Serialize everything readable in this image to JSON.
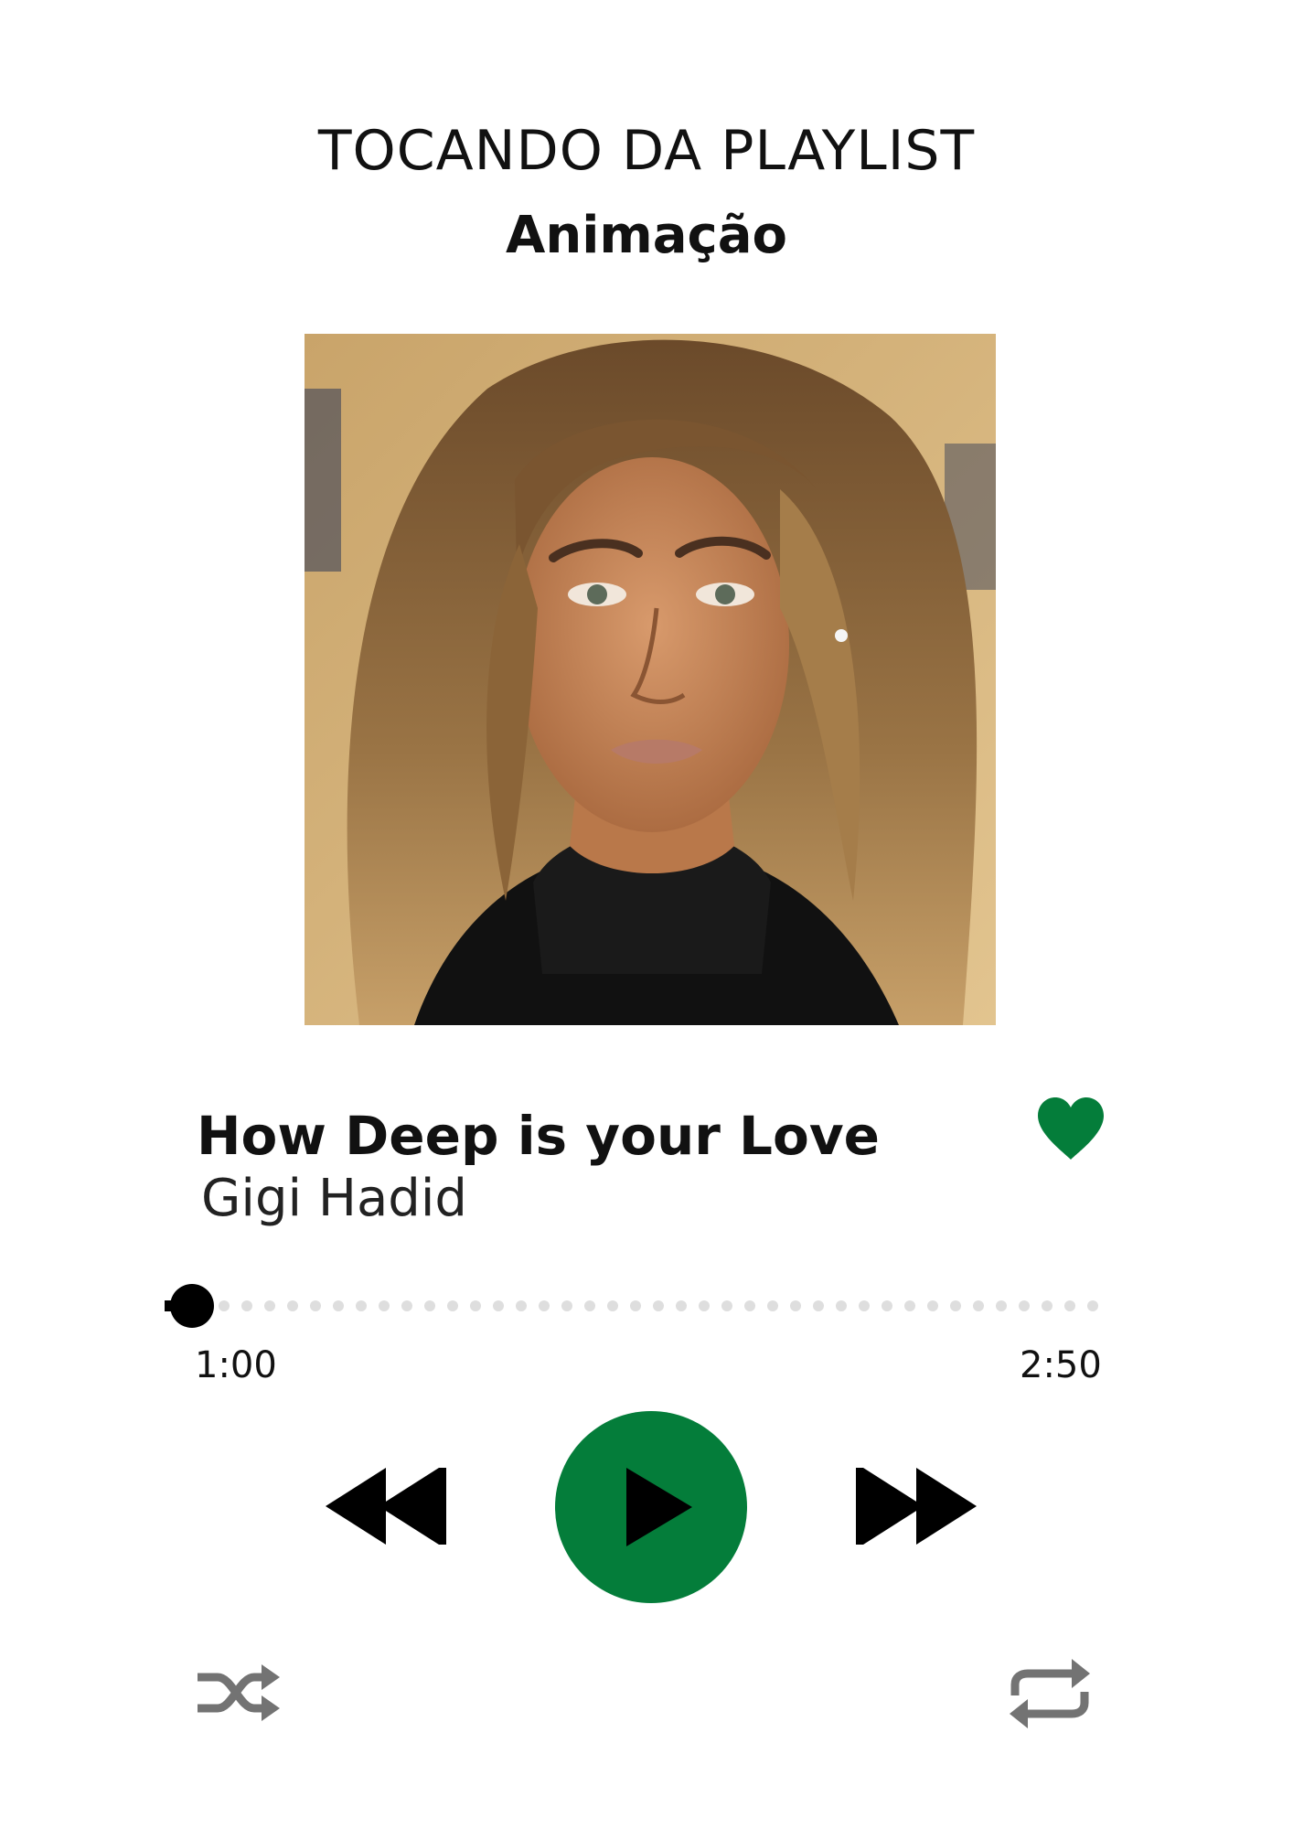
{
  "header": {
    "subtitle": "TOCANDO DA PLAYLIST",
    "playlist_name": "Animação"
  },
  "track": {
    "title": "How Deep is your Love",
    "artist": "Gigi Hadid",
    "liked": true
  },
  "progress": {
    "current_time": "1:00",
    "total_time": "2:50"
  },
  "controls": {
    "rewind_icon": "rewind-icon",
    "play_icon": "play-icon",
    "forward_icon": "fast-forward-icon",
    "shuffle_icon": "shuffle-icon",
    "repeat_icon": "repeat-icon",
    "heart_icon": "heart-icon"
  },
  "colors": {
    "accent": "#047d3a",
    "icon_gray": "#737373",
    "dot_gray": "#dedede"
  }
}
